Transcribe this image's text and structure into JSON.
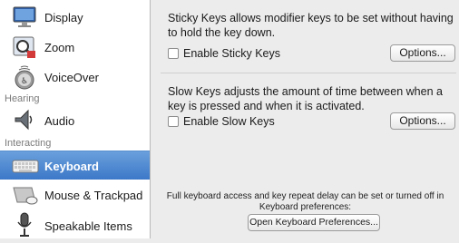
{
  "sidebar": {
    "items": [
      {
        "label": "Display",
        "icon": "display-icon"
      },
      {
        "label": "Zoom",
        "icon": "zoom-icon"
      },
      {
        "label": "VoiceOver",
        "icon": "voiceover-icon"
      },
      {
        "label": "Audio",
        "icon": "speaker-icon"
      },
      {
        "label": "Keyboard",
        "icon": "keyboard-icon",
        "selected": true
      },
      {
        "label": "Mouse & Trackpad",
        "icon": "mouse-icon"
      },
      {
        "label": "Speakable Items",
        "icon": "microphone-icon"
      }
    ],
    "sections": {
      "hearing": "Hearing",
      "interacting": "Interacting"
    }
  },
  "main": {
    "sticky_keys": {
      "description": "Sticky Keys allows modifier keys to be set without having to hold the key down.",
      "checkbox_label": "Enable Sticky Keys",
      "checked": false,
      "options_label": "Options..."
    },
    "slow_keys": {
      "description": "Slow Keys adjusts the amount of time between when a key is pressed and when it is activated.",
      "checkbox_label": "Enable Slow Keys",
      "checked": false,
      "options_label": "Options..."
    },
    "footer": {
      "note": "Full keyboard access and key repeat delay can be set or turned off in Keyboard preferences:",
      "button_label": "Open Keyboard Preferences..."
    }
  },
  "colors": {
    "selection": "#3c78c8",
    "sidebar_bg": "#ffffff",
    "pane_bg": "#ececec"
  }
}
